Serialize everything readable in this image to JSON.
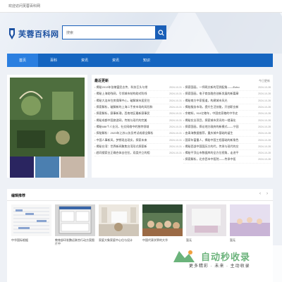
{
  "topbar": {
    "welcome": "欢迎访问芙蓉百科网"
  },
  "logo": {
    "text": "芙蓉百科网"
  },
  "search": {
    "placeholder": "搜索"
  },
  "nav": {
    "items": [
      "首页",
      "百科",
      "资讯",
      "资讯",
      "知识"
    ]
  },
  "latest": {
    "title": "最近更新",
    "more": "今日更新"
  },
  "news_left": [
    {
      "title": "揭秘2013年张掖富民志传、科技巨头与常",
      "date": "2024-10-31"
    },
    {
      "title": "揭秘上海助残网，引领城市结构助对防线",
      "date": "2024-10-31"
    },
    {
      "title": "揭秘大连市住房保障中心，破解城市居民住",
      "date": "2024-10-31"
    },
    {
      "title": "探索解析，破解新的上海二手房市场的风险和",
      "date": "2024-10-31"
    },
    {
      "title": "探索解析，赛事新潮，西南地区最新赛事民",
      "date": "2024-10-31"
    },
    {
      "title": "揭秘成都中国旅游网，传统与现代的完美",
      "date": "2024-10-31"
    },
    {
      "title": "揭秘686个人业况，社交网络中的独特领域",
      "date": "2024-10-31"
    },
    {
      "title": "探秘解析：2023年江苏公务员考试成绩全解析",
      "date": "2024-10-31"
    },
    {
      "title": "中国人事新风，梦想现出现实，探索未来",
      "date": "2024-10-31"
    },
    {
      "title": "揭秘台湾：世界新闻聚焦台湾形式探索新",
      "date": "2024-10-31"
    },
    {
      "title": "趋同搜索业正确合体去往拉，双类并立的相",
      "date": "2024-10-31"
    }
  ],
  "news_right": [
    {
      "title": "探索国画，一师两文新的范例配角——Echo",
      "date": "2024-10-28"
    },
    {
      "title": "探索国画，电子商务融合创新发展的新篇章",
      "date": "2024-10-28"
    },
    {
      "title": "揭秘南方中家报道，构建城市风光",
      "date": "2024-10-28"
    },
    {
      "title": "揭秘服务市场，提升生活技能，开创职业新",
      "date": "2024-10-28"
    },
    {
      "title": "余粮知，910亿粮车，中国农家粮的中华史",
      "date": "2024-10-28"
    },
    {
      "title": "揭秘实业项目，探索城市资讯的一缕清化",
      "date": "2024-10-28"
    },
    {
      "title": "探索国画，探论地方政府的新模式——宁园",
      "date": "2024-10-28"
    },
    {
      "title": "由青海数据推荐，重庆城乡基础的诞生",
      "date": "2024-10-28"
    },
    {
      "title": "国家年富重人，揭秘中国工程基础的新角色",
      "date": "2024-10-28"
    },
    {
      "title": "揭秘西部中国国历方的代，传承与现代的交",
      "date": "2024-10-28"
    },
    {
      "title": "揭秘平顶山市数据库的全方位视角，走进平",
      "date": "2024-10-28"
    },
    {
      "title": "探索解析，北京西市中医院——传承中医",
      "date": "2024-10-28"
    }
  ],
  "recommend": {
    "title": "编辑推荐"
  },
  "cards": [
    {
      "caption": "中华国际根据"
    },
    {
      "caption": "教育部印发鹏远联合行动方案图片中"
    },
    {
      "caption": "家庭大象家庭中心位与设计"
    },
    {
      "caption": "中国代表学界的大华"
    },
    {
      "caption": "暂无"
    },
    {
      "caption": "暂无"
    }
  ],
  "watermark": {
    "line1": "自动秒收录",
    "line2": "更多精彩 · 未来 · 主动收录"
  },
  "colors": {
    "brand": "#1565c0",
    "nav_active": "#2b7fe0",
    "accent_green": "#6bb37b"
  },
  "icons": {
    "search": "search-icon",
    "arrow_left": "chevron-left-icon",
    "arrow_right": "chevron-right-icon"
  }
}
